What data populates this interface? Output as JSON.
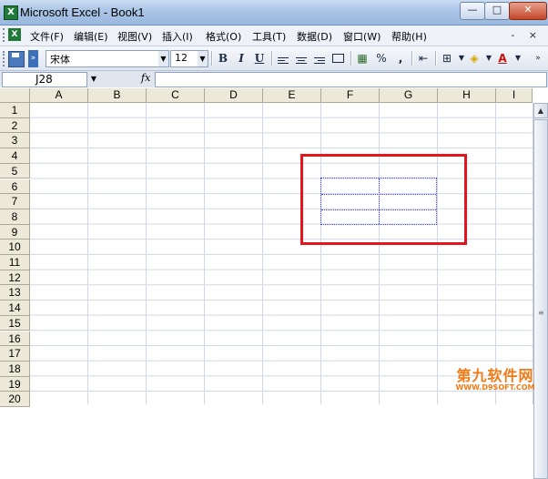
{
  "window": {
    "title": "Microsoft Excel - Book1",
    "app_icon": "excel-icon",
    "min": "—",
    "max": "□",
    "close": "✕"
  },
  "menu": {
    "items": [
      "文件(F)",
      "编辑(E)",
      "视图(V)",
      "插入(I)",
      "格式(O)",
      "工具(T)",
      "数据(D)",
      "窗口(W)",
      "帮助(H)"
    ],
    "doc_controls": "-  ×"
  },
  "toolbar": {
    "font_name": "宋体",
    "font_size": "12",
    "bold": "B",
    "italic": "I",
    "underline": "U",
    "percent": "%",
    "comma": ","
  },
  "formula_bar": {
    "name_box": "J28",
    "fx": "fx",
    "value": ""
  },
  "sheet": {
    "columns": [
      "A",
      "B",
      "C",
      "D",
      "E",
      "F",
      "G",
      "H",
      "I"
    ],
    "rows": [
      "1",
      "2",
      "3",
      "4",
      "5",
      "6",
      "7",
      "8",
      "9",
      "10",
      "11",
      "12",
      "13",
      "14",
      "15",
      "16",
      "17",
      "18",
      "19",
      "20"
    ],
    "highlight_color": "#e3161d",
    "selection_border_color": "#3a3aff"
  },
  "watermark": {
    "main": "第九软件网",
    "sub": "WWW.D9SOFT.COM"
  }
}
